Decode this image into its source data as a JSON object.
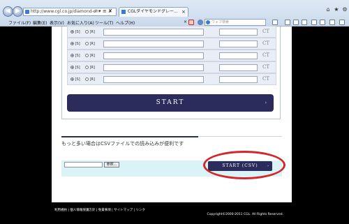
{
  "browser": {
    "url": "http://www.cgl.co.jp/diamond-ch",
    "address_icons": "⌕ ▾ ≡ ✘",
    "tab_title": "CGLダイヤモンドグレー...",
    "tab_close": "×",
    "window_buttons": {
      "home": "⌂",
      "star": "★",
      "gear": "⚙"
    },
    "menu": [
      "ファイル(F)",
      "編集(E)",
      "表示(V)",
      "お気に入り(A)",
      "ツール(T)",
      "ヘルプ(H)"
    ],
    "menu_close": "×",
    "search_placeholder": "ウェブ検索"
  },
  "form": {
    "rows": [
      {
        "opt1": "[S]",
        "opt2": "[R]",
        "unit": "CT",
        "selected": "S"
      },
      {
        "opt1": "[S]",
        "opt2": "[R]",
        "unit": "CT",
        "selected": "S"
      },
      {
        "opt1": "[S]",
        "opt2": "[R]",
        "unit": "CT",
        "selected": "S"
      },
      {
        "opt1": "[S]",
        "opt2": "[R]",
        "unit": "CT",
        "selected": "S"
      },
      {
        "opt1": "[S]",
        "opt2": "[R]",
        "unit": "CT",
        "selected": "S"
      }
    ],
    "start_label": "START",
    "start_arrow": "›"
  },
  "csv": {
    "description": "もっと多い場合はCSVファイルでの読み込みが便利です",
    "browse_label": "参照...",
    "button_label": "START (CSV)",
    "button_arrow": "›"
  },
  "footer": {
    "links": "利用規約 | 個人情報保護方針 | 免責事項 | サイトマップ | リンク",
    "copyright": "Copyright©2000-2011 CGL. All Rights Reserved."
  },
  "colors": {
    "accent": "#2b2c5c",
    "highlight_circle": "#d4272a",
    "csv_panel": "#d9f3f7"
  }
}
